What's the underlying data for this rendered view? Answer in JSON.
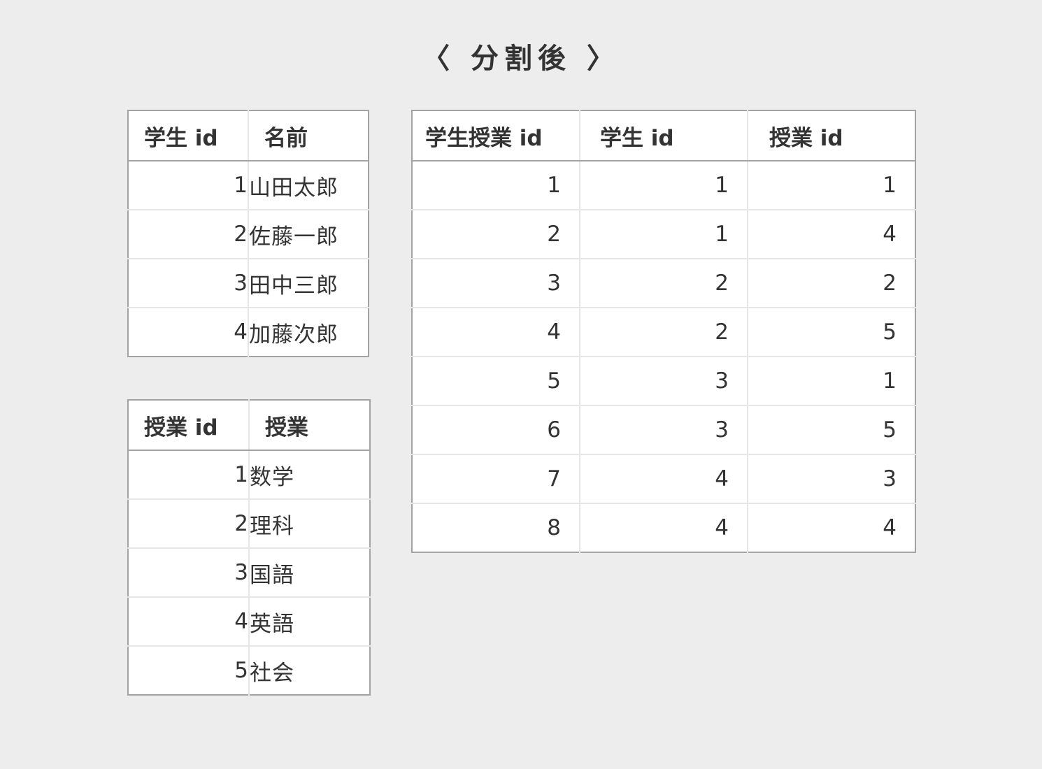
{
  "title": "〈 分割後 〉",
  "students": {
    "headers": [
      "学生 id",
      "名前"
    ],
    "rows": [
      [
        "1",
        "山田太郎"
      ],
      [
        "2",
        "佐藤一郎"
      ],
      [
        "3",
        "田中三郎"
      ],
      [
        "4",
        "加藤次郎"
      ]
    ]
  },
  "courses": {
    "headers": [
      "授業 id",
      "授業"
    ],
    "rows": [
      [
        "1",
        "数学"
      ],
      [
        "2",
        "理科"
      ],
      [
        "3",
        "国語"
      ],
      [
        "4",
        "英語"
      ],
      [
        "5",
        "社会"
      ]
    ]
  },
  "enrollments": {
    "headers": [
      "学生授業 id",
      "学生 id",
      "授業 id"
    ],
    "rows": [
      [
        "1",
        "1",
        "1"
      ],
      [
        "2",
        "1",
        "4"
      ],
      [
        "3",
        "2",
        "2"
      ],
      [
        "4",
        "2",
        "5"
      ],
      [
        "5",
        "3",
        "1"
      ],
      [
        "6",
        "3",
        "5"
      ],
      [
        "7",
        "4",
        "3"
      ],
      [
        "8",
        "4",
        "4"
      ]
    ]
  },
  "colors": {
    "background": "#ededed",
    "table_bg": "#ffffff",
    "outer_border": "#a3a3a3",
    "inner_border": "#e6e6e6",
    "text": "#333333"
  }
}
